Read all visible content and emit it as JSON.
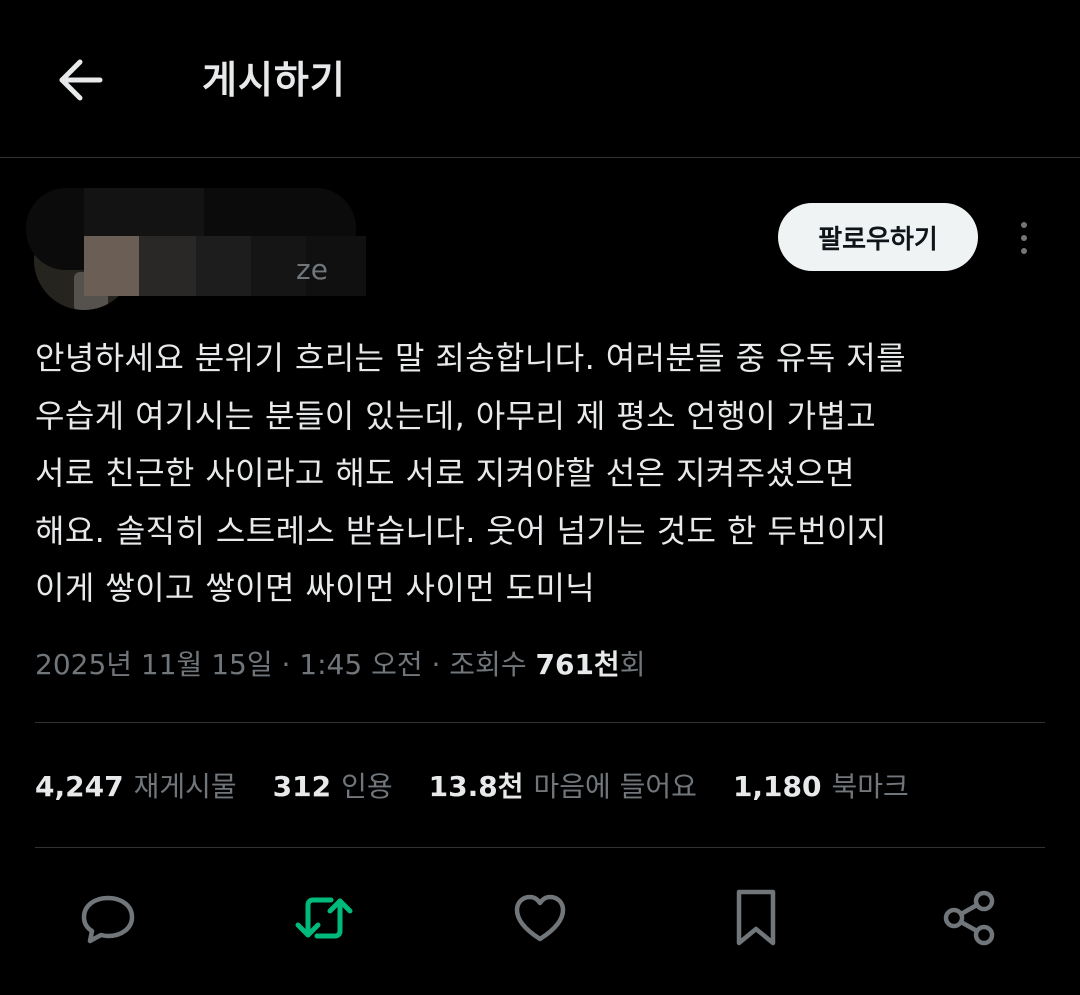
{
  "header": {
    "title": "게시하기"
  },
  "author": {
    "handle_fragment": "ze",
    "follow_label": "팔로우하기"
  },
  "post": {
    "lines": [
      "안녕하세요 분위기 흐리는 말 죄송합니다. 여러분들 중 유독 저를",
      "우습게 여기시는 분들이 있는데, 아무리 제 평소 언행이 가볍고",
      "서로 친근한 사이라고 해도 서로 지켜야할 선은 지켜주셨으면",
      "해요. 솔직히 스트레스 받습니다. 웃어 넘기는 것도 한 두번이지",
      "이게 쌓이고 쌓이면 싸이먼 사이먼 도미닉"
    ],
    "timestamp": "2025년 11월 15일 · 1:45 오전 · 조회수 ",
    "views_count": "761천",
    "views_suffix": "회"
  },
  "stats": {
    "reposts": {
      "value": "4,247",
      "label": "재게시물"
    },
    "quotes": {
      "value": "312",
      "label": "인용"
    },
    "likes": {
      "value": "13.8천",
      "label": "마음에 들어요"
    },
    "bookmarks": {
      "value": "1,180",
      "label": "북마크"
    }
  },
  "colors": {
    "background": "#000000",
    "text_primary": "#e7e9ea",
    "text_secondary": "#71767b",
    "divider": "#2f3336",
    "repost_active": "#00ba7c",
    "follow_button_bg": "#eff3f4"
  },
  "icons": {
    "back": "arrow-left-icon",
    "more": "more-vertical-icon",
    "reply": "speech-bubble-icon",
    "repost": "repost-icon",
    "like": "heart-icon",
    "bookmark": "bookmark-icon",
    "share": "share-icon"
  }
}
